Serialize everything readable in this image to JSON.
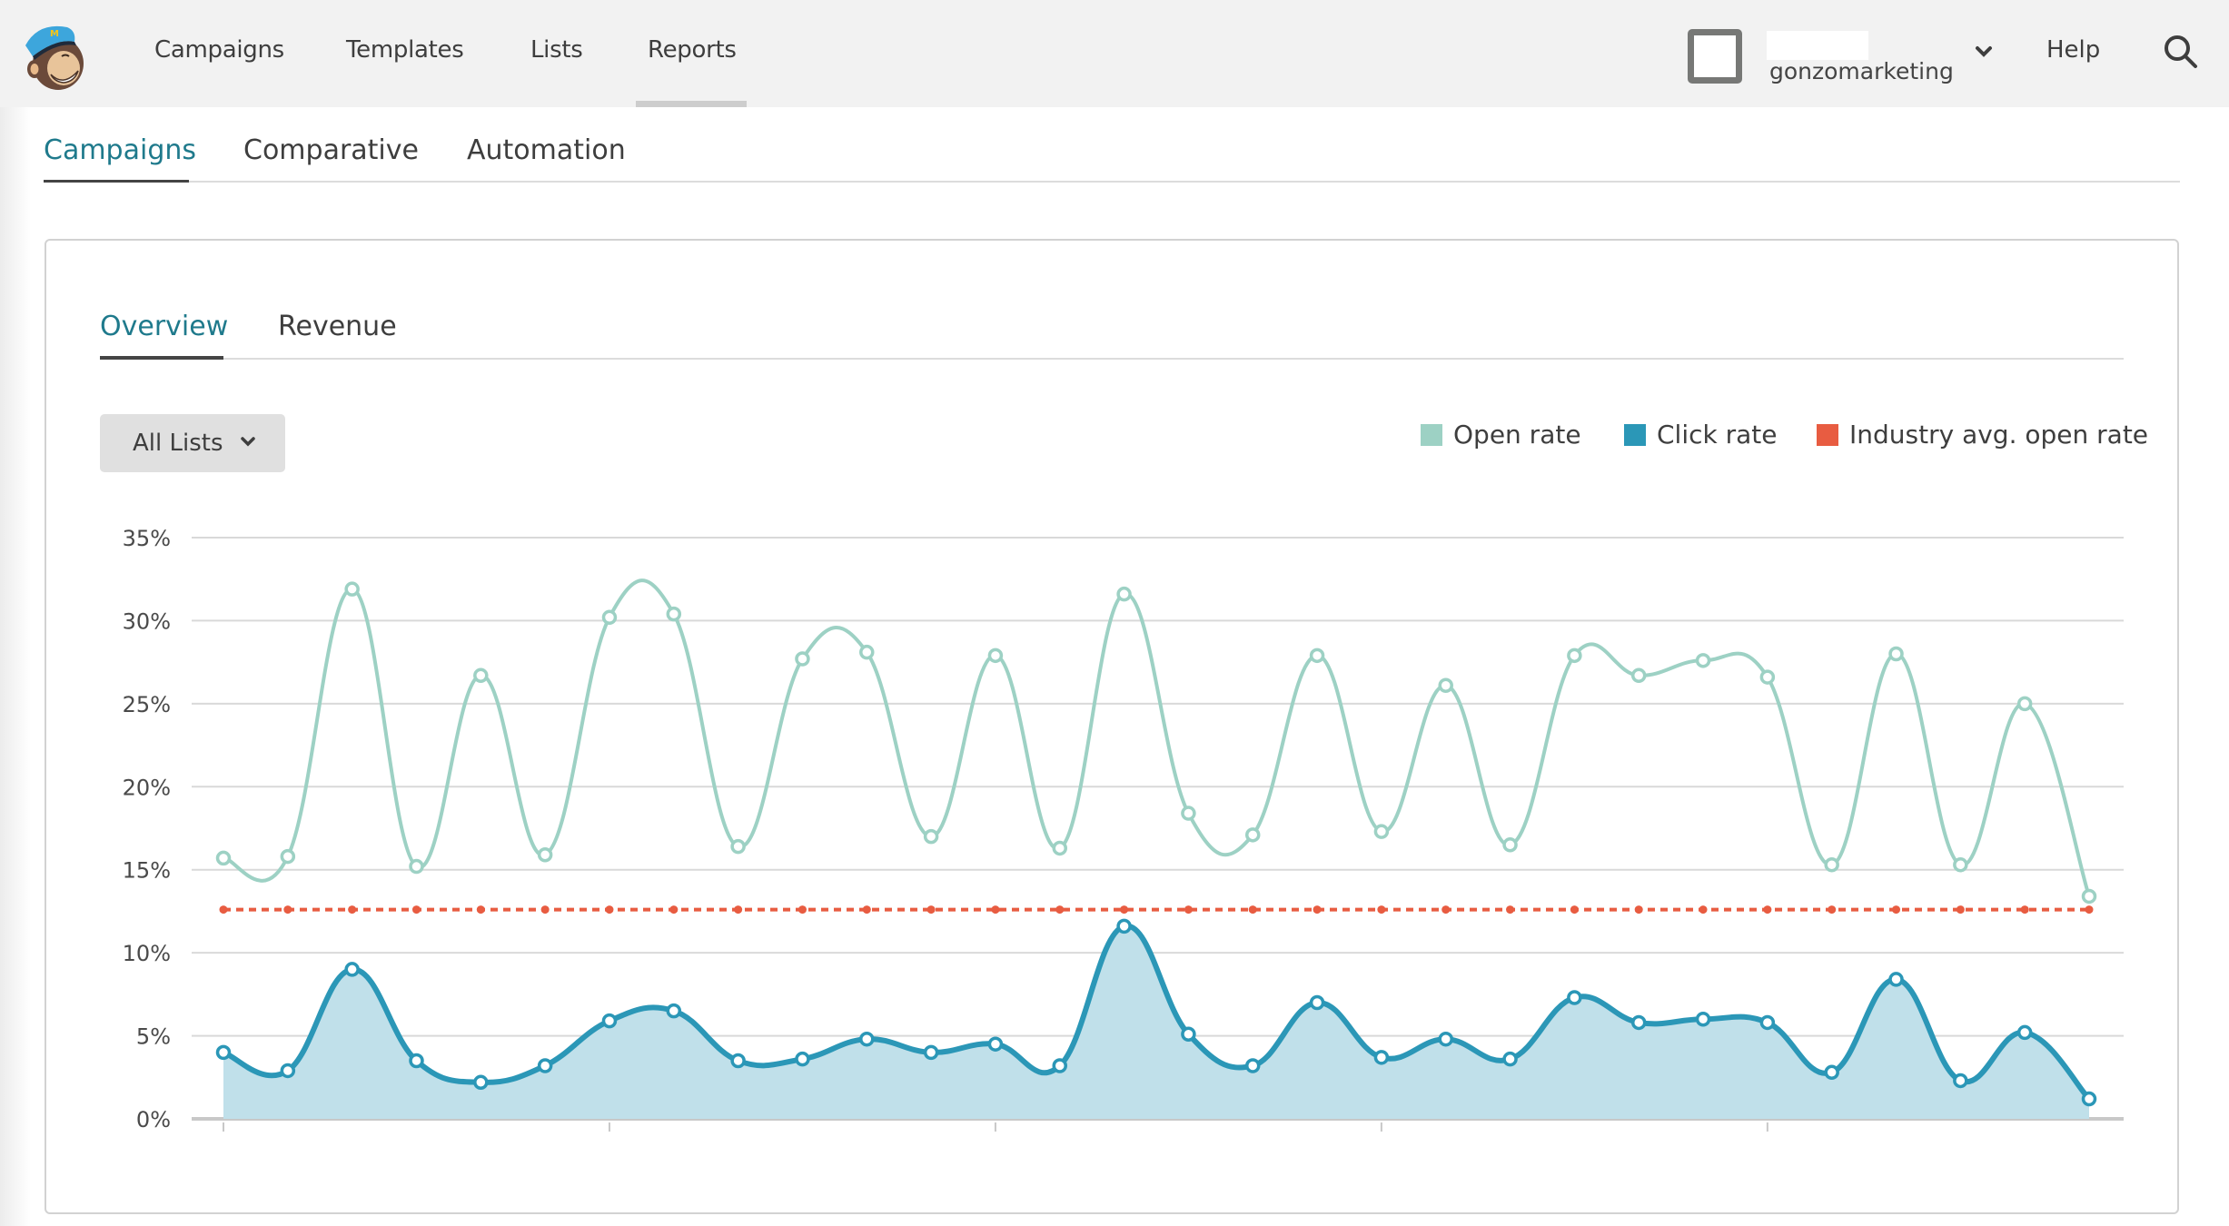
{
  "header": {
    "nav": [
      {
        "label": "Campaigns",
        "active": false
      },
      {
        "label": "Templates",
        "active": false
      },
      {
        "label": "Lists",
        "active": false
      },
      {
        "label": "Reports",
        "active": true
      }
    ],
    "account": {
      "org_name": "gonzomarketing",
      "chevron_icon": "chevron-down-icon",
      "avatar_icon": "avatar-placeholder"
    },
    "help_label": "Help",
    "search_icon": "search-icon",
    "logo_icon": "mailchimp-freddie-logo"
  },
  "report_tabs": [
    {
      "label": "Campaigns",
      "active": true
    },
    {
      "label": "Comparative",
      "active": false
    },
    {
      "label": "Automation",
      "active": false
    }
  ],
  "card": {
    "tabs": [
      {
        "label": "Overview",
        "active": true
      },
      {
        "label": "Revenue",
        "active": false
      }
    ],
    "list_filter": {
      "selected": "All Lists",
      "icon": "chevron-down-icon"
    }
  },
  "colors": {
    "open_rate": "#9dd1c4",
    "click_rate": "#2b97b7",
    "click_fill": "#c0e0ea",
    "industry_avg": "#e85c41",
    "active_tab": "#1f7a8c"
  },
  "chart_data": {
    "type": "line",
    "title": "",
    "xlabel": "",
    "ylabel": "",
    "ylim": [
      0,
      35
    ],
    "yticks": [
      0,
      5,
      10,
      15,
      20,
      25,
      30,
      35
    ],
    "ytick_labels": [
      "0%",
      "5%",
      "10%",
      "15%",
      "20%",
      "25%",
      "30%",
      "35%"
    ],
    "x_tick_indices": [
      0,
      6,
      12,
      18,
      24
    ],
    "grid": true,
    "legend_position": "top-right",
    "x": [
      1,
      2,
      3,
      4,
      5,
      6,
      7,
      8,
      9,
      10,
      11,
      12,
      13,
      14,
      15,
      16,
      17,
      18,
      19,
      20,
      21,
      22,
      23,
      24,
      25,
      26,
      27,
      28,
      29,
      30
    ],
    "series": [
      {
        "name": "Open rate",
        "style": "smooth-line",
        "values": [
          15.7,
          15.8,
          31.9,
          15.2,
          26.7,
          15.9,
          30.2,
          30.4,
          16.4,
          27.7,
          28.1,
          17.0,
          27.9,
          16.3,
          31.6,
          18.4,
          17.1,
          27.9,
          17.3,
          26.1,
          16.5,
          27.9,
          26.7,
          27.6,
          26.6,
          15.3,
          28.0,
          15.3,
          25.0,
          13.4
        ]
      },
      {
        "name": "Click rate",
        "style": "smooth-area",
        "values": [
          4.0,
          2.9,
          9.0,
          3.5,
          2.2,
          3.2,
          5.9,
          6.5,
          3.5,
          3.6,
          4.8,
          4.0,
          4.5,
          3.2,
          11.6,
          5.1,
          3.2,
          7.0,
          3.7,
          4.8,
          3.6,
          7.3,
          5.8,
          6.0,
          5.8,
          2.8,
          8.4,
          2.3,
          5.2,
          1.2
        ]
      },
      {
        "name": "Industry avg. open rate",
        "style": "dotted-line",
        "values": [
          12.6,
          12.6,
          12.6,
          12.6,
          12.6,
          12.6,
          12.6,
          12.6,
          12.6,
          12.6,
          12.6,
          12.6,
          12.6,
          12.6,
          12.6,
          12.6,
          12.6,
          12.6,
          12.6,
          12.6,
          12.6,
          12.6,
          12.6,
          12.6,
          12.6,
          12.6,
          12.6,
          12.6,
          12.6,
          12.6
        ]
      }
    ]
  }
}
